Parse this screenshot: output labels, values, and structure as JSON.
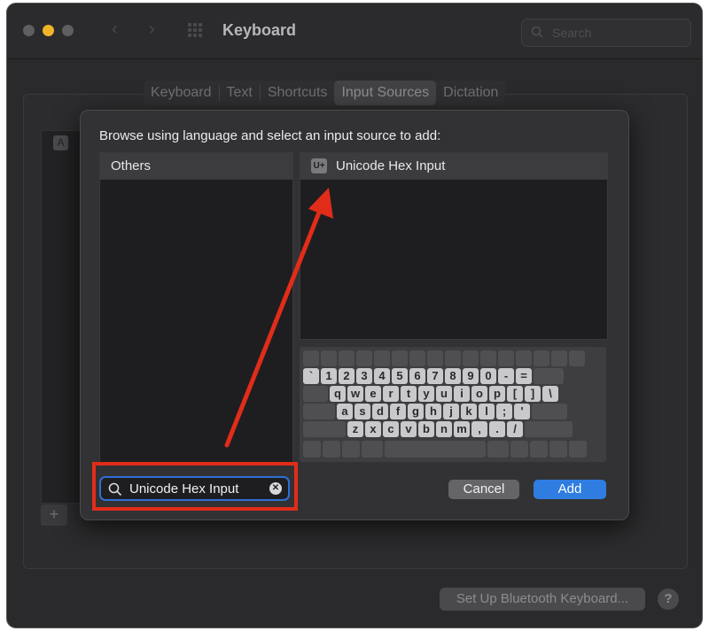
{
  "window": {
    "title": "Keyboard",
    "search_placeholder": "Search"
  },
  "tabs": [
    {
      "label": "Keyboard"
    },
    {
      "label": "Text"
    },
    {
      "label": "Shortcuts"
    },
    {
      "label": "Input Sources",
      "active": true
    },
    {
      "label": "Dictation"
    }
  ],
  "sidebar": {
    "input_icon_letter": "A",
    "add_label": "+"
  },
  "footer": {
    "bluetooth_button": "Set Up Bluetooth Keyboard...",
    "help_label": "?"
  },
  "sheet": {
    "prompt": "Browse using language and select an input source to add:",
    "languages": [
      {
        "label": "Others",
        "selected": true
      }
    ],
    "sources": [
      {
        "badge": "U+",
        "label": "Unicode Hex Input",
        "selected": true
      }
    ],
    "search_value": "Unicode Hex Input",
    "cancel_label": "Cancel",
    "add_label": "Add"
  },
  "keyboard": {
    "row1": [
      "`",
      "1",
      "2",
      "3",
      "4",
      "5",
      "6",
      "7",
      "8",
      "9",
      "0",
      "-",
      "="
    ],
    "row2": [
      "q",
      "w",
      "e",
      "r",
      "t",
      "y",
      "u",
      "i",
      "o",
      "p",
      "[",
      "]",
      "\\"
    ],
    "row3": [
      "a",
      "s",
      "d",
      "f",
      "g",
      "h",
      "j",
      "k",
      "l",
      ";",
      "'"
    ],
    "row4": [
      "z",
      "x",
      "c",
      "v",
      "b",
      "n",
      "m",
      ",",
      ".",
      "/"
    ]
  },
  "colors": {
    "accent": "#2f7de1",
    "highlight": "#e22c1a",
    "window_bg": "#2a2a2c"
  }
}
